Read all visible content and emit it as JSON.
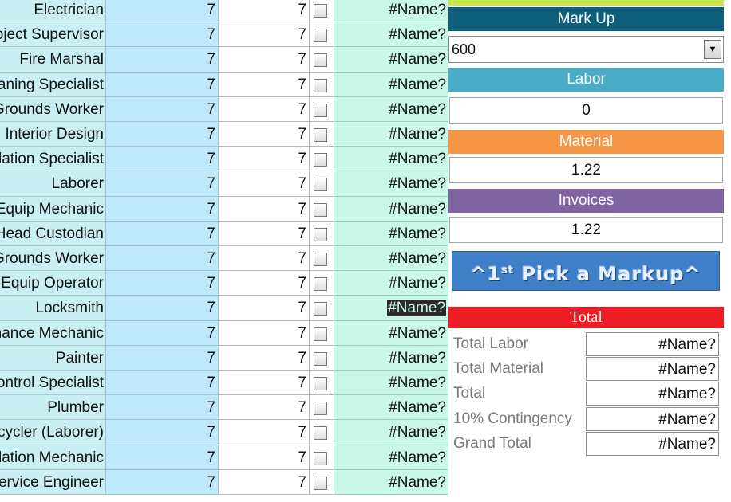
{
  "grid": {
    "rows": [
      {
        "trade": "Electrician",
        "a": "7",
        "b": "7",
        "result": "#Name?"
      },
      {
        "trade": "Project Supervisor",
        "a": "7",
        "b": "7",
        "result": "#Name?"
      },
      {
        "trade": "Fire Marshal",
        "a": "7",
        "b": "7",
        "result": "#Name?"
      },
      {
        "trade": "Cleaning Specialist",
        "a": "7",
        "b": "7",
        "result": "#Name?"
      },
      {
        "trade": "Grounds Worker",
        "a": "7",
        "b": "7",
        "result": "#Name?"
      },
      {
        "trade": "Interior Design",
        "a": "7",
        "b": "7",
        "result": "#Name?"
      },
      {
        "trade": "Installation Specialist",
        "a": "7",
        "b": "7",
        "result": "#Name?"
      },
      {
        "trade": "Laborer",
        "a": "7",
        "b": "7",
        "result": "#Name?"
      },
      {
        "trade": "Equip Mechanic",
        "a": "7",
        "b": "7",
        "result": "#Name?"
      },
      {
        "trade": "Head Custodian",
        "a": "7",
        "b": "7",
        "result": "#Name?"
      },
      {
        "trade": "Grounds Worker",
        "a": "7",
        "b": "7",
        "result": "#Name?"
      },
      {
        "trade": "Equip Operator",
        "a": "7",
        "b": "7",
        "result": "#Name?"
      },
      {
        "trade": "Locksmith",
        "a": "7",
        "b": "7",
        "result": "#Name?"
      },
      {
        "trade": "Maintenance Mechanic",
        "a": "7",
        "b": "7",
        "result": "#Name?"
      },
      {
        "trade": "Painter",
        "a": "7",
        "b": "7",
        "result": "#Name?"
      },
      {
        "trade": "Control Specialist",
        "a": "7",
        "b": "7",
        "result": "#Name?"
      },
      {
        "trade": "Plumber",
        "a": "7",
        "b": "7",
        "result": "#Name?"
      },
      {
        "trade": "Recycler (Laborer)",
        "a": "7",
        "b": "7",
        "result": "#Name?"
      },
      {
        "trade": "Ventilation Mechanic",
        "a": "7",
        "b": "7",
        "result": "#Name?"
      },
      {
        "trade": "Service Engineer",
        "a": "7",
        "b": "7",
        "result": "#Name?"
      }
    ],
    "selected_row_index": 12
  },
  "panel": {
    "markup": {
      "label": "Mark Up",
      "value": "600",
      "color": "#0d5f7a"
    },
    "labor": {
      "label": "Labor",
      "value": "0",
      "color": "#4aacc6"
    },
    "material": {
      "label": "Material",
      "value": "1.22",
      "color": "#f79646"
    },
    "invoices": {
      "label": "Invoices",
      "value": "1.22",
      "color": "#8064a2"
    },
    "pick_button": {
      "prefix": "^1",
      "sup": "st",
      "suffix": " Pick a Markup^"
    },
    "total": {
      "label": "Total",
      "rows": [
        {
          "label": "Total Labor",
          "value": "#Name?"
        },
        {
          "label": "Total Material",
          "value": "#Name?"
        },
        {
          "label": "Total",
          "value": "#Name?"
        },
        {
          "label": "10% Contingency",
          "value": "#Name?"
        },
        {
          "label": "Grand Total",
          "value": "#Name?"
        }
      ]
    }
  }
}
